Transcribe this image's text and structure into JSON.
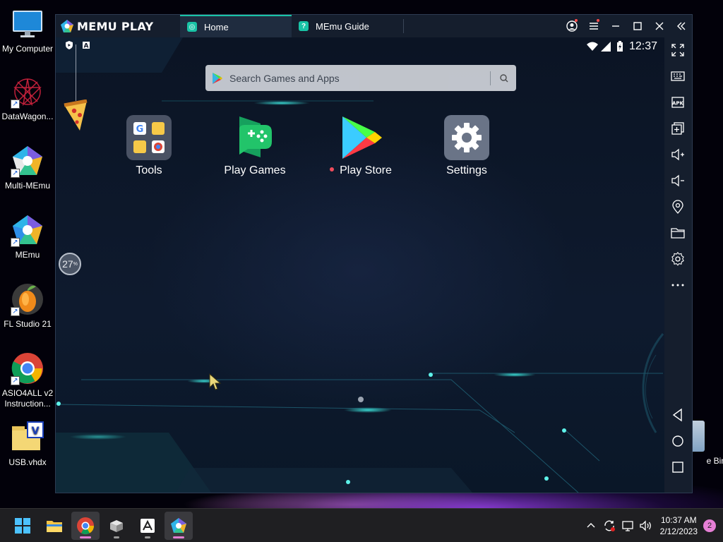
{
  "desktop": {
    "icons": [
      {
        "label": "My Computer",
        "icon": "monitor-icon"
      },
      {
        "label": "DataWagon...",
        "icon": "datawagon-icon"
      },
      {
        "label": "Multi-MEmu",
        "icon": "multi-memu-icon"
      },
      {
        "label": "MEmu",
        "icon": "memu-icon"
      },
      {
        "label": "FL Studio 21",
        "icon": "fl-studio-icon"
      },
      {
        "label": "ASIO4ALL v2 Instruction...",
        "icon": "chrome-icon"
      },
      {
        "label": "USB.vhdx",
        "icon": "vhdx-icon"
      }
    ],
    "recycle_bin_label": "e Bin"
  },
  "memu": {
    "brand": "MEMU PLAY",
    "tabs": [
      {
        "label": "Home",
        "active": true
      },
      {
        "label": "MEmu Guide",
        "active": false
      }
    ],
    "status": {
      "time": "12:37"
    },
    "search": {
      "placeholder": "Search Games and Apps"
    },
    "apps": [
      {
        "label": "Tools",
        "icon": "tools-folder-icon"
      },
      {
        "label": "Play Games",
        "icon": "play-games-icon"
      },
      {
        "label": "Play Store",
        "icon": "play-store-icon",
        "new_dot": true
      },
      {
        "label": "Settings",
        "icon": "settings-gear-icon"
      }
    ],
    "temperature": {
      "value": "27",
      "unit": "%"
    },
    "side_tools": [
      "fullscreen-icon",
      "keyboard-icon",
      "apk-icon",
      "multi-instance-icon",
      "volume-up-icon",
      "volume-down-icon",
      "location-icon",
      "folder-icon",
      "settings-icon",
      "more-icon",
      "back-icon",
      "home-icon",
      "recents-icon"
    ],
    "apk_label": "APK"
  },
  "taskbar": {
    "clock_time": "10:37 AM",
    "clock_date": "2/12/2023",
    "notification_count": "2"
  },
  "colors": {
    "accent": "#19c3a6",
    "titlebar": "#151e2d",
    "taskbar": "#1f1f22",
    "notif": "#e67fd6"
  }
}
